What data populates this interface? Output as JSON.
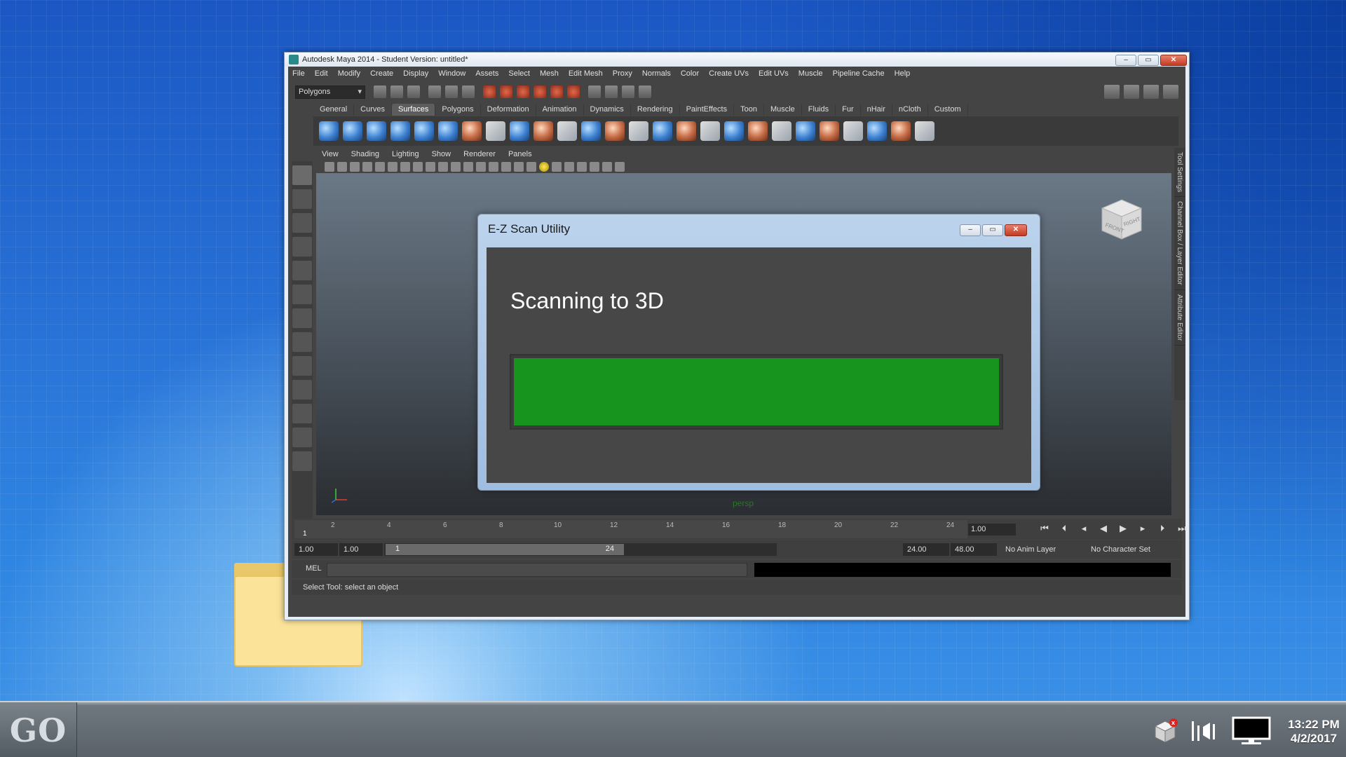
{
  "maya": {
    "title": "Autodesk Maya 2014 - Student Version: untitled*",
    "menus": [
      "File",
      "Edit",
      "Modify",
      "Create",
      "Display",
      "Window",
      "Assets",
      "Select",
      "Mesh",
      "Edit Mesh",
      "Proxy",
      "Normals",
      "Color",
      "Create UVs",
      "Edit UVs",
      "Muscle",
      "Pipeline Cache",
      "Help"
    ],
    "mode": "Polygons",
    "shelf_tabs": [
      "General",
      "Curves",
      "Surfaces",
      "Polygons",
      "Deformation",
      "Animation",
      "Dynamics",
      "Rendering",
      "PaintEffects",
      "Toon",
      "Muscle",
      "Fluids",
      "Fur",
      "nHair",
      "nCloth",
      "Custom"
    ],
    "active_shelf_tab": "Surfaces",
    "panel_menus": [
      "View",
      "Shading",
      "Lighting",
      "Show",
      "Renderer",
      "Panels"
    ],
    "side_tabs": [
      "Tool Settings",
      "Channel Box / Layer Editor",
      "Attribute Editor"
    ],
    "viewport_label": "persp",
    "view_cube": {
      "front": "FRONT",
      "right": "RIGHT"
    },
    "time_ticks": [
      "2",
      "4",
      "6",
      "8",
      "10",
      "12",
      "14",
      "16",
      "18",
      "20",
      "22",
      "24"
    ],
    "timeline_start_frame": "1",
    "current_time": "1.00",
    "range": {
      "start_time": "1.00",
      "playback_start": "1.00",
      "slider_start": "1",
      "slider_end": "24",
      "playback_end": "24.00",
      "end_time": "48.00",
      "anim_layer": "No Anim Layer",
      "character_set": "No Character Set"
    },
    "command_label": "MEL",
    "help_line": "Select Tool: select an object"
  },
  "dialog": {
    "title": "E-Z Scan Utility",
    "heading": "Scanning to 3D",
    "progress": 1.0,
    "progress_color": "#16941e"
  },
  "taskbar": {
    "start_label": "GO",
    "clock_time": "13:22 PM",
    "clock_date": "4/2/2017"
  }
}
